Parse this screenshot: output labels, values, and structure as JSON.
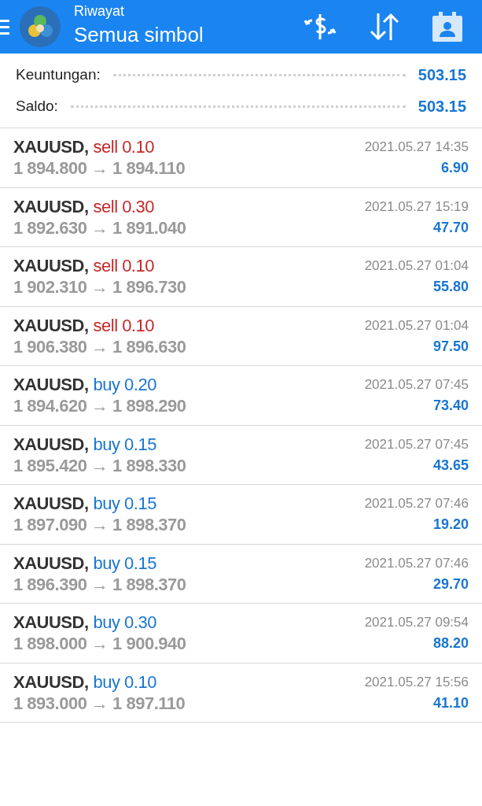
{
  "header": {
    "title": "Riwayat",
    "subtitle": "Semua simbol"
  },
  "summary": [
    {
      "label": "Keuntungan:",
      "value": "503.15"
    },
    {
      "label": "Saldo:",
      "value": "503.15"
    }
  ],
  "deals": [
    {
      "symbol": "XAUUSD,",
      "kind": "sell",
      "side": "sell 0.10",
      "prices": "1 894.800 → 1 894.110",
      "time": "2021.05.27 14:35",
      "profit": "6.90"
    },
    {
      "symbol": "XAUUSD,",
      "kind": "sell",
      "side": "sell 0.30",
      "prices": "1 892.630 → 1 891.040",
      "time": "2021.05.27 15:19",
      "profit": "47.70"
    },
    {
      "symbol": "XAUUSD,",
      "kind": "sell",
      "side": "sell 0.10",
      "prices": "1 902.310 → 1 896.730",
      "time": "2021.05.27 01:04",
      "profit": "55.80"
    },
    {
      "symbol": "XAUUSD,",
      "kind": "sell",
      "side": "sell 0.10",
      "prices": "1 906.380 → 1 896.630",
      "time": "2021.05.27 01:04",
      "profit": "97.50"
    },
    {
      "symbol": "XAUUSD,",
      "kind": "buy",
      "side": "buy 0.20",
      "prices": "1 894.620 → 1 898.290",
      "time": "2021.05.27 07:45",
      "profit": "73.40"
    },
    {
      "symbol": "XAUUSD,",
      "kind": "buy",
      "side": "buy 0.15",
      "prices": "1 895.420 → 1 898.330",
      "time": "2021.05.27 07:45",
      "profit": "43.65"
    },
    {
      "symbol": "XAUUSD,",
      "kind": "buy",
      "side": "buy 0.15",
      "prices": "1 897.090 → 1 898.370",
      "time": "2021.05.27 07:46",
      "profit": "19.20"
    },
    {
      "symbol": "XAUUSD,",
      "kind": "buy",
      "side": "buy 0.15",
      "prices": "1 896.390 → 1 898.370",
      "time": "2021.05.27 07:46",
      "profit": "29.70"
    },
    {
      "symbol": "XAUUSD,",
      "kind": "buy",
      "side": "buy 0.30",
      "prices": "1 898.000 → 1 900.940",
      "time": "2021.05.27 09:54",
      "profit": "88.20"
    },
    {
      "symbol": "XAUUSD,",
      "kind": "buy",
      "side": "buy 0.10",
      "prices": "1 893.000 → 1 897.110",
      "time": "2021.05.27 15:56",
      "profit": "41.10"
    }
  ]
}
